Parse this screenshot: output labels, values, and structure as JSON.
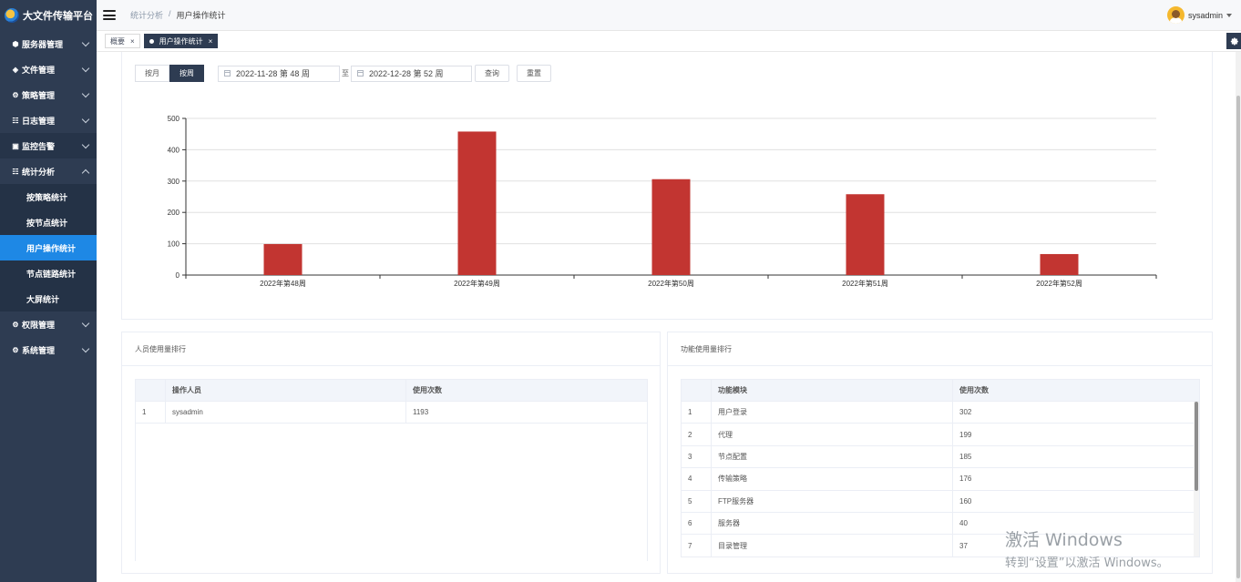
{
  "app": {
    "title": "大文件传输平台"
  },
  "sidebar": {
    "items": [
      {
        "label": "服务器管理",
        "icon": "cube-icon"
      },
      {
        "label": "文件管理",
        "icon": "layers-icon"
      },
      {
        "label": "策略管理",
        "icon": "gear-icon"
      },
      {
        "label": "日志管理",
        "icon": "list-icon"
      },
      {
        "label": "监控告警",
        "icon": "monitor-icon"
      },
      {
        "label": "统计分析",
        "icon": "list-icon"
      },
      {
        "label": "权限管理",
        "icon": "gear-icon"
      },
      {
        "label": "系统管理",
        "icon": "gear-icon"
      }
    ],
    "sub_items": [
      "按策略统计",
      "按节点统计",
      "用户操作统计",
      "节点链路统计",
      "大屏统计"
    ]
  },
  "header": {
    "breadcrumb": [
      "统计分析",
      "/",
      "用户操作统计"
    ],
    "username": "sysadmin"
  },
  "tags": [
    {
      "label": "概要",
      "close": "×"
    },
    {
      "label": "用户操作统计",
      "close": "×"
    }
  ],
  "filters": {
    "by_month": "按月",
    "by_week": "按周",
    "start_date": "2022-11-28 第 48 周",
    "to": "至",
    "end_date": "2022-12-28 第 52 周",
    "query": "查询",
    "reset": "重置"
  },
  "chart_data": {
    "type": "bar",
    "categories": [
      "2022年第48周",
      "2022年第49周",
      "2022年第50周",
      "2022年第51周",
      "2022年第52周"
    ],
    "values": [
      99,
      458,
      306,
      258,
      67
    ],
    "ylim": [
      0,
      500
    ],
    "yticks": [
      0,
      100,
      200,
      300,
      400,
      500
    ],
    "bar_color": "#c23531",
    "grid": true
  },
  "user_ranking": {
    "title": "人员使用量排行",
    "columns": [
      "",
      "操作人员",
      "使用次数"
    ],
    "rows": [
      [
        "1",
        "sysadmin",
        "1193"
      ]
    ]
  },
  "function_ranking": {
    "title": "功能使用量排行",
    "columns": [
      "",
      "功能模块",
      "使用次数"
    ],
    "rows": [
      [
        "1",
        "用户登录",
        "302"
      ],
      [
        "2",
        "代理",
        "199"
      ],
      [
        "3",
        "节点配置",
        "185"
      ],
      [
        "4",
        "传输策略",
        "176"
      ],
      [
        "5",
        "FTP服务器",
        "160"
      ],
      [
        "6",
        "服务器",
        "40"
      ],
      [
        "7",
        "目录管理",
        "37"
      ]
    ]
  },
  "watermark": {
    "line1": "激活 Windows",
    "line2": "转到“设置”以激活 Windows。"
  }
}
